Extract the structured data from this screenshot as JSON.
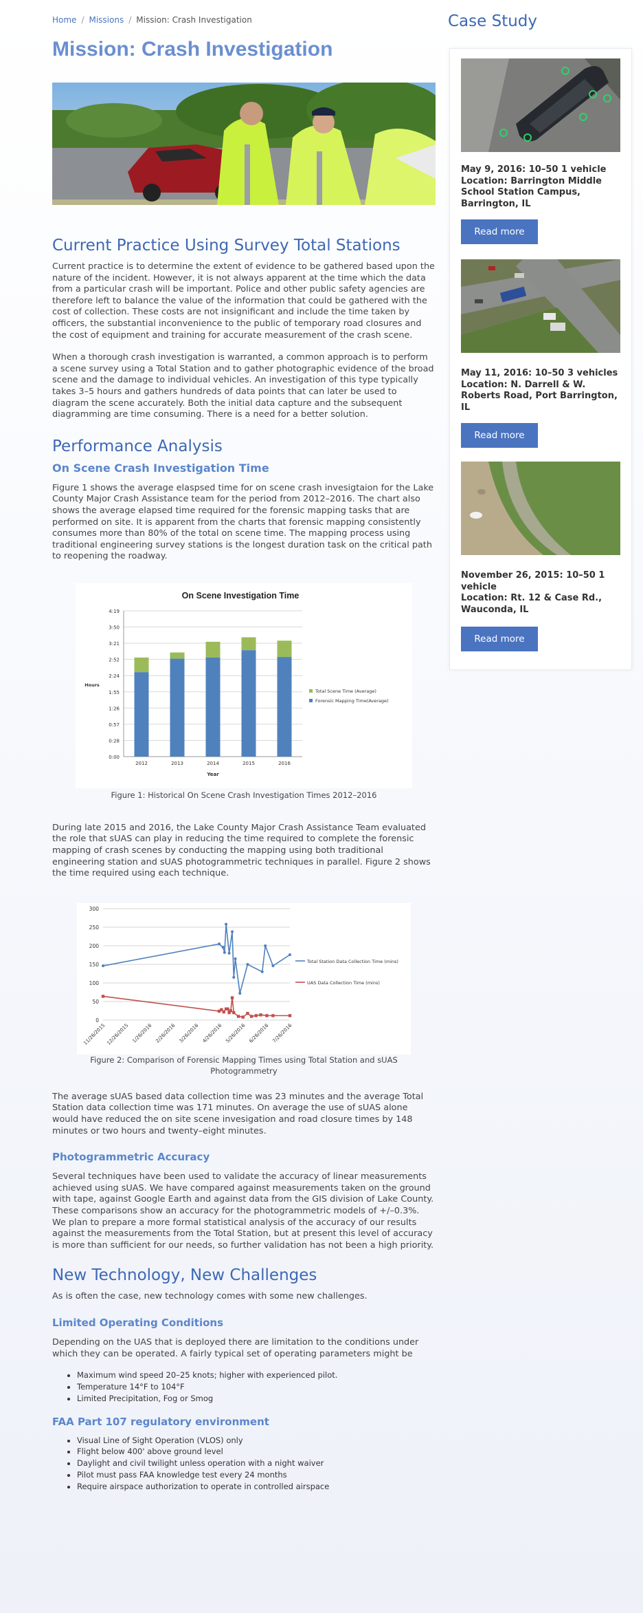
{
  "breadcrumb": {
    "home": "Home",
    "missions": "Missions",
    "current": "Mission: Crash Investigation"
  },
  "page_title": "Mission: Crash Investigation",
  "sections": {
    "current_practice": {
      "heading": "Current Practice Using Survey Total Stations",
      "p1": "Current practice is to determine the extent of evidence to be gathered based upon the nature of the incident. However, it is not always apparent at the time which the data from a particular crash will be important. Police and other public safety agencies are therefore left to balance the value of the information that could be gathered with the cost of collection. These costs are not insignificant and include the time taken by officers, the substantial inconvenience to the public of temporary road closures and the cost of equipment and training for accurate measurement of the crash scene.",
      "p2": "When a thorough crash investigation is warranted, a common approach is to perform a scene survey using a Total Station and to gather photographic evidence of the broad scene and the damage to individual vehicles. An investigation of this type typically takes 3–5 hours and gathers hundreds of data points that can later be used to diagram the scene accurately. Both the initial data capture and the subsequent diagramming are time consuming. There is a need for a better solution."
    },
    "performance": {
      "heading": "Performance Analysis",
      "sub1": "On Scene Crash Investigation Time",
      "p1": "Figure 1 shows the average elaspsed time for on scene crash invesigtaion for the Lake County Major Crash Assistance team for the period from 2012–2016. The chart also shows the average elapsed time required for the forensic mapping tasks that are performed on site. It is apparent from the charts that forensic mapping consistently consumes more than 80% of the total on scene time. The mapping process using traditional engineering survey stations is the longest duration task on the critical path to reopening the roadway.",
      "caption1": "Figure 1: Historical On Scene Crash Investigation Times 2012–2016",
      "p2": "During late 2015 and 2016, the Lake County Major Crash Assistance Team evaluated the role that sUAS can play in reducing the time required to complete the forensic mapping of crash scenes by conducting the mapping using both traditional engineering station and sUAS photogrammetric techniques in parallel. Figure 2 shows the time required using each technique.",
      "caption2": "Figure 2: Comparison of Forensic Mapping Times using Total Station and sUAS Photogrammetry",
      "p3": "The average sUAS based data collection time was 23 minutes and the average Total Station data collection time was 171 minutes. On average the use of sUAS alone would have reduced the on site scene invesigation and road closure times by 148 minutes or two hours and twenty–eight minutes.",
      "sub2": "Photogrammetric Accuracy",
      "p4": "Several techniques have been used to validate the accuracy of linear measurements achieved using sUAS. We have compared against measurements taken on the ground with tape, against Google Earth and against data from the GIS division of Lake County. These comparisons show an accuracy for the photogrammetric models of +/–0.3%. We plan to prepare a more formal statistical analysis of the accuracy of our results against the measurements from the Total Station, but at present this level of accuracy is more than sufficient for our needs, so further validation has not been a high priority."
    },
    "new_tech": {
      "heading": "New Technology, New Challenges",
      "p1": "As is often the case, new technology comes with some new challenges.",
      "sub1": "Limited Operating Conditions",
      "p2": "Depending on the UAS that is deployed there are limitation to the conditions under which they can be operated.  A fairly typical set of operating parameters might be",
      "bullets1": [
        "Maximum wind speed 20–25 knots; higher with experienced pilot.",
        "Temperature 14°F to 104°F",
        "Limited Precipitation, Fog or Smog"
      ],
      "sub2": "FAA Part 107 regulatory environment",
      "bullets2": [
        "Visual Line of Sight Operation (VLOS) only",
        "Flight below 400' above ground level",
        "Daylight and civil twilight unless operation with a night waiver",
        "Pilot must pass FAA knowledge test every 24 months",
        "Require airspace authorization to operate in controlled airspace"
      ]
    }
  },
  "sidebar": {
    "title": "Case Study",
    "cases": [
      {
        "date": "May 9, 2016: 10–50 1 vehicle",
        "location": "Location: Barrington Middle School Station Campus, Barrington, IL",
        "button": "Read more"
      },
      {
        "date": "May 11, 2016: 10–50 3 vehicles",
        "location": "Location: N. Darrell & W. Roberts Road, Port Barrington, IL",
        "button": "Read more"
      },
      {
        "date": "November 26, 2015: 10–50 1 vehicle",
        "location": "Location: Rt. 12 & Case Rd., Wauconda, IL",
        "button": "Read more"
      }
    ]
  },
  "chart_data": [
    {
      "type": "bar",
      "title": "On Scene Investigation Time",
      "xlabel": "Year",
      "ylabel": "Hours",
      "categories": [
        "2012",
        "2013",
        "2014",
        "2015",
        "2016"
      ],
      "yticks": [
        "0:00",
        "0:28",
        "0:57",
        "1:26",
        "1:55",
        "2:24",
        "2:52",
        "3:21",
        "3:50",
        "4:19"
      ],
      "ylim": [
        0,
        259
      ],
      "series": [
        {
          "name": "Forensic Mapping Time(Average)",
          "color": "#4f81bd",
          "values": [
            150,
            174,
            176,
            189,
            177
          ]
        },
        {
          "name": "Total Scene Time (Average)",
          "color": "#9bbb59",
          "values": [
            176,
            185,
            204,
            212,
            206
          ]
        }
      ],
      "legend": "right",
      "grid": true
    },
    {
      "type": "line",
      "title": "",
      "xlabel": "",
      "ylabel": "",
      "xticks": [
        "11/26/2015",
        "12/26/2015",
        "1/26/2016",
        "2/26/2016",
        "3/26/2016",
        "4/26/2016",
        "5/26/2016",
        "6/26/2016",
        "7/26/2016"
      ],
      "xlim": [
        "2015-11-26",
        "2016-07-26"
      ],
      "ylim": [
        0,
        300
      ],
      "yticks": [
        "0",
        "50",
        "100",
        "150",
        "200",
        "250",
        "300"
      ],
      "series": [
        {
          "name": "Total Station Data Collection Time (mins)",
          "color": "#4f81bd",
          "x": [
            "2015-11-26",
            "2016-04-25",
            "2016-04-30",
            "2016-05-02",
            "2016-05-04",
            "2016-05-08",
            "2016-05-12",
            "2016-05-14",
            "2016-05-16",
            "2016-05-22",
            "2016-06-01",
            "2016-06-20",
            "2016-06-24",
            "2016-07-04",
            "2016-07-26"
          ],
          "y": [
            146,
            205,
            196,
            182,
            258,
            180,
            238,
            115,
            165,
            72,
            150,
            130,
            200,
            146,
            176
          ]
        },
        {
          "name": "UAS Data Collection Time (mins)",
          "color": "#c0504d",
          "x": [
            "2015-11-26",
            "2016-04-25",
            "2016-04-28",
            "2016-05-01",
            "2016-05-04",
            "2016-05-06",
            "2016-05-08",
            "2016-05-10",
            "2016-05-12",
            "2016-05-14",
            "2016-05-20",
            "2016-05-26",
            "2016-06-01",
            "2016-06-06",
            "2016-06-12",
            "2016-06-18",
            "2016-06-26",
            "2016-07-04",
            "2016-07-26"
          ],
          "y": [
            64,
            24,
            28,
            22,
            30,
            30,
            20,
            25,
            60,
            20,
            10,
            8,
            18,
            10,
            12,
            14,
            12,
            12,
            12
          ]
        }
      ],
      "legend": "right",
      "grid": true
    }
  ]
}
